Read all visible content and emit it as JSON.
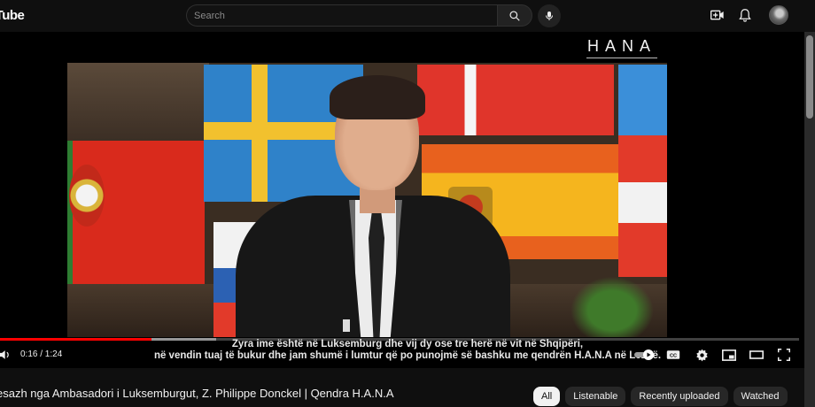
{
  "header": {
    "logo_text": "uTube",
    "search_placeholder": "Search",
    "icons": [
      "search-icon",
      "mic-icon",
      "create-video-icon",
      "notifications-icon",
      "avatar"
    ]
  },
  "player": {
    "watermark": "HANA",
    "subtitles": {
      "line1": "Zyra ime është në Luksemburg dhe vij dy ose tre herë në vit në Shqipëri,",
      "line2": "në vendin tuaj të bukur dhe jam shumë i lumtur që po punojmë së bashku me qendrën H.A.N.A në Lezhë."
    },
    "time_display": "0:16 / 1:24",
    "progress_fraction": 0.19,
    "buffered_fraction": 0.27,
    "autoplay_on": true,
    "icons": [
      "volume-icon",
      "autoplay-toggle",
      "captions-icon",
      "settings-icon",
      "miniplayer-icon",
      "theater-mode-icon",
      "fullscreen-icon"
    ]
  },
  "below": {
    "video_title": "esazh nga Ambasadori i Luksemburgut, Z. Philippe Donckel | Qendra H.A.N.A",
    "chips": [
      "All",
      "Listenable",
      "Recently uploaded",
      "Watched"
    ],
    "active_chip": "All"
  },
  "colors": {
    "background": "#0f0f0f",
    "progress": "#ff0000",
    "chip_bg": "#272727",
    "chip_active_bg": "#f1f1f1"
  }
}
